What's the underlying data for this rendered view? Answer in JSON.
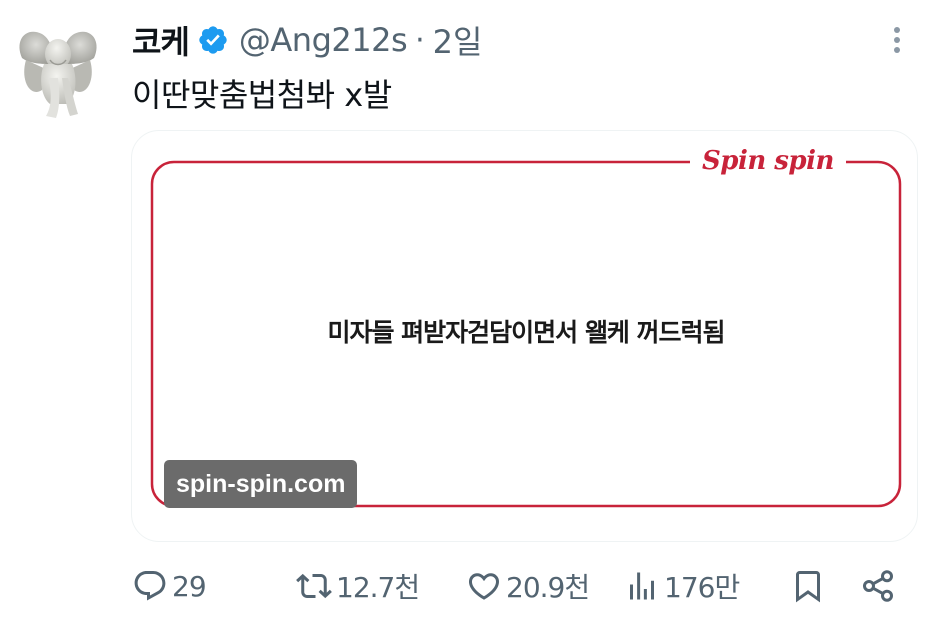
{
  "tweet": {
    "display_name": "코케",
    "handle": "@Ang212s",
    "separator": "·",
    "time": "2일",
    "text": "이딴맞춤법첨봐 x발"
  },
  "media": {
    "brand": "Spin spin",
    "text": "미자들 펴받자걷담이면서 왤케 꺼드럭됨",
    "watermark": "spin-spin.com",
    "frame_color": "#c8233a"
  },
  "actions": {
    "reply_count": "29",
    "retweet_count": "12.7천",
    "like_count": "20.9천",
    "view_count": "176만"
  },
  "icons": {
    "verified": "verified-badge-icon",
    "more": "more-vertical-icon",
    "reply": "reply-icon",
    "retweet": "retweet-icon",
    "like": "heart-icon",
    "views": "views-icon",
    "bookmark": "bookmark-icon",
    "share": "share-icon"
  },
  "colors": {
    "verified_blue": "#1d9bf0",
    "secondary_text": "#536471",
    "primary_text": "#0f1419"
  }
}
